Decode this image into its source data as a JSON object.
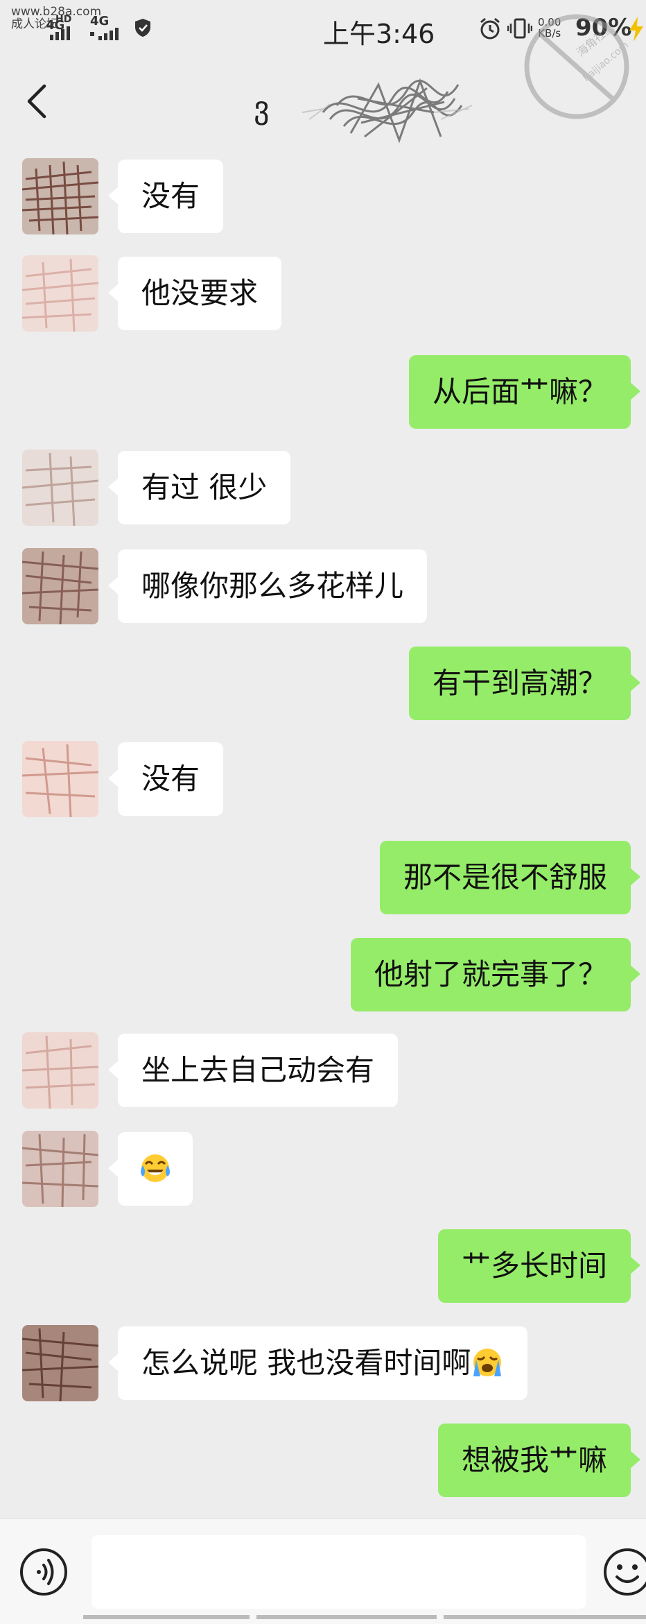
{
  "status_bar": {
    "watermark_site": "www.b28a.com",
    "watermark_label": "成人论坛",
    "signal_1": "4G",
    "signal_2": "4G",
    "hd": "HD",
    "time": "上午3:46",
    "speed_value": "0.00",
    "speed_unit": "KB/s",
    "battery": "90%"
  },
  "watermark_logo": {
    "line_1": "海角社区",
    "line_2": "haijiao.com"
  },
  "header": {
    "title_prefix": "ვ"
  },
  "messages": [
    {
      "side": "in",
      "text": "没有"
    },
    {
      "side": "in",
      "text": "他没要求"
    },
    {
      "side": "out",
      "text": "从后面艹嘛？"
    },
    {
      "side": "in",
      "text": "有过 很少"
    },
    {
      "side": "in",
      "text": "哪像你那么多花样儿"
    },
    {
      "side": "out",
      "text": "有干到高潮？"
    },
    {
      "side": "in",
      "text": "没有"
    },
    {
      "side": "out",
      "text": "那不是很不舒服"
    },
    {
      "side": "out",
      "text": "他射了就完事了？"
    },
    {
      "side": "in",
      "text": "坐上去自己动会有"
    },
    {
      "side": "in",
      "emoji": "tears-of-joy"
    },
    {
      "side": "out",
      "text": "艹多长时间"
    },
    {
      "side": "in",
      "text": "怎么说呢 我也没看时间啊",
      "emoji": "loudly-crying"
    },
    {
      "side": "out",
      "text": "想被我艹嘛"
    }
  ],
  "input_bar": {
    "voice_icon": "voice-icon",
    "emoji_icon": "smiley-icon"
  },
  "colors": {
    "background": "#ededed",
    "bubble_in": "#ffffff",
    "bubble_out": "#95ec69"
  }
}
